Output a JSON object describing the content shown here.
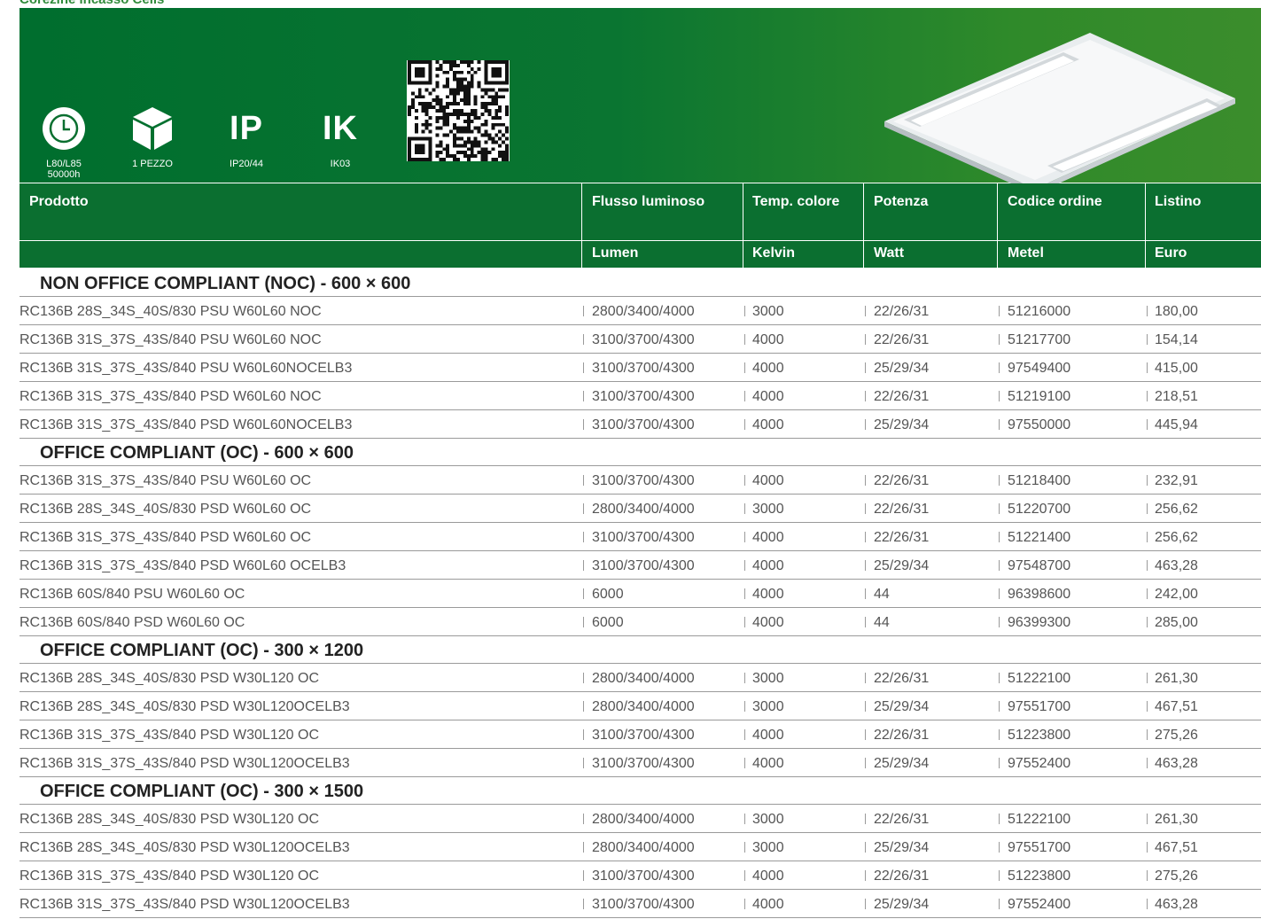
{
  "page": {
    "top_title": "Corezine incasso Cells"
  },
  "features": [
    {
      "icon": "clock-icon",
      "label_line1": "L80/L85",
      "label_line2": "50000h"
    },
    {
      "icon": "box-icon",
      "label_line1": "1 PEZZO",
      "label_line2": ""
    },
    {
      "icon_text": "IP",
      "label_line1": "IP20/44",
      "label_line2": ""
    },
    {
      "icon_text": "IK",
      "label_line1": "IK03",
      "label_line2": ""
    }
  ],
  "table": {
    "headers": [
      "Prodotto",
      "Flusso luminoso",
      "Temp. colore",
      "Potenza",
      "Codice ordine",
      "Listino"
    ],
    "units": [
      "",
      "Lumen",
      "Kelvin",
      "Watt",
      "Metel",
      "Euro"
    ],
    "sections": [
      {
        "title": "NON OFFICE COMPLIANT (NOC) - 600 × 600",
        "rows": [
          [
            "RC136B 28S_34S_40S/830 PSU W60L60 NOC",
            "2800/3400/4000",
            "3000",
            "22/26/31",
            "51216000",
            "180,00"
          ],
          [
            "RC136B 31S_37S_43S/840 PSU W60L60 NOC",
            "3100/3700/4300",
            "4000",
            "22/26/31",
            "51217700",
            "154,14"
          ],
          [
            "RC136B 31S_37S_43S/840 PSU W60L60NOCELB3",
            "3100/3700/4300",
            "4000",
            "25/29/34",
            "97549400",
            "415,00"
          ],
          [
            "RC136B 31S_37S_43S/840 PSD W60L60 NOC",
            "3100/3700/4300",
            "4000",
            "22/26/31",
            "51219100",
            "218,51"
          ],
          [
            "RC136B 31S_37S_43S/840 PSD W60L60NOCELB3",
            "3100/3700/4300",
            "4000",
            "25/29/34",
            "97550000",
            "445,94"
          ]
        ]
      },
      {
        "title": "OFFICE COMPLIANT (OC) - 600 × 600",
        "rows": [
          [
            "RC136B 31S_37S_43S/840 PSU W60L60 OC",
            "3100/3700/4300",
            "4000",
            "22/26/31",
            "51218400",
            "232,91"
          ],
          [
            "RC136B 28S_34S_40S/830 PSD W60L60 OC",
            "2800/3400/4000",
            "3000",
            "22/26/31",
            "51220700",
            "256,62"
          ],
          [
            "RC136B 31S_37S_43S/840 PSD W60L60 OC",
            "3100/3700/4300",
            "4000",
            "22/26/31",
            "51221400",
            "256,62"
          ],
          [
            "RC136B 31S_37S_43S/840 PSD W60L60 OCELB3",
            "3100/3700/4300",
            "4000",
            "25/29/34",
            "97548700",
            "463,28"
          ],
          [
            "RC136B 60S/840 PSU W60L60 OC",
            "6000",
            "4000",
            "44",
            "96398600",
            "242,00"
          ],
          [
            "RC136B 60S/840 PSD W60L60 OC",
            "6000",
            "4000",
            "44",
            "96399300",
            "285,00"
          ]
        ]
      },
      {
        "title": "OFFICE COMPLIANT (OC) - 300 × 1200",
        "rows": [
          [
            "RC136B 28S_34S_40S/830 PSD W30L120 OC",
            "2800/3400/4000",
            "3000",
            "22/26/31",
            "51222100",
            "261,30"
          ],
          [
            "RC136B 28S_34S_40S/830 PSD W30L120OCELB3",
            "2800/3400/4000",
            "3000",
            "25/29/34",
            "97551700",
            "467,51"
          ],
          [
            "RC136B 31S_37S_43S/840 PSD W30L120 OC",
            "3100/3700/4300",
            "4000",
            "22/26/31",
            "51223800",
            "275,26"
          ],
          [
            "RC136B 31S_37S_43S/840 PSD W30L120OCELB3",
            "3100/3700/4300",
            "4000",
            "25/29/34",
            "97552400",
            "463,28"
          ]
        ]
      },
      {
        "title": "OFFICE COMPLIANT (OC) - 300 × 1500",
        "rows": [
          [
            "RC136B 28S_34S_40S/830 PSD W30L120 OC",
            "2800/3400/4000",
            "3000",
            "22/26/31",
            "51222100",
            "261,30"
          ],
          [
            "RC136B 28S_34S_40S/830 PSD W30L120OCELB3",
            "2800/3400/4000",
            "3000",
            "25/29/34",
            "97551700",
            "467,51"
          ],
          [
            "RC136B 31S_37S_43S/840 PSD W30L120 OC",
            "3100/3700/4300",
            "4000",
            "22/26/31",
            "51223800",
            "275,26"
          ],
          [
            "RC136B 31S_37S_43S/840 PSD W30L120OCELB3",
            "3100/3700/4300",
            "4000",
            "25/29/34",
            "97552400",
            "463,28"
          ]
        ]
      }
    ]
  },
  "colors": {
    "header_green": "#0b6f30",
    "banner_dark": "#006e2e",
    "banner_light": "#3b8d2c",
    "title_green": "#2f8a3a"
  }
}
